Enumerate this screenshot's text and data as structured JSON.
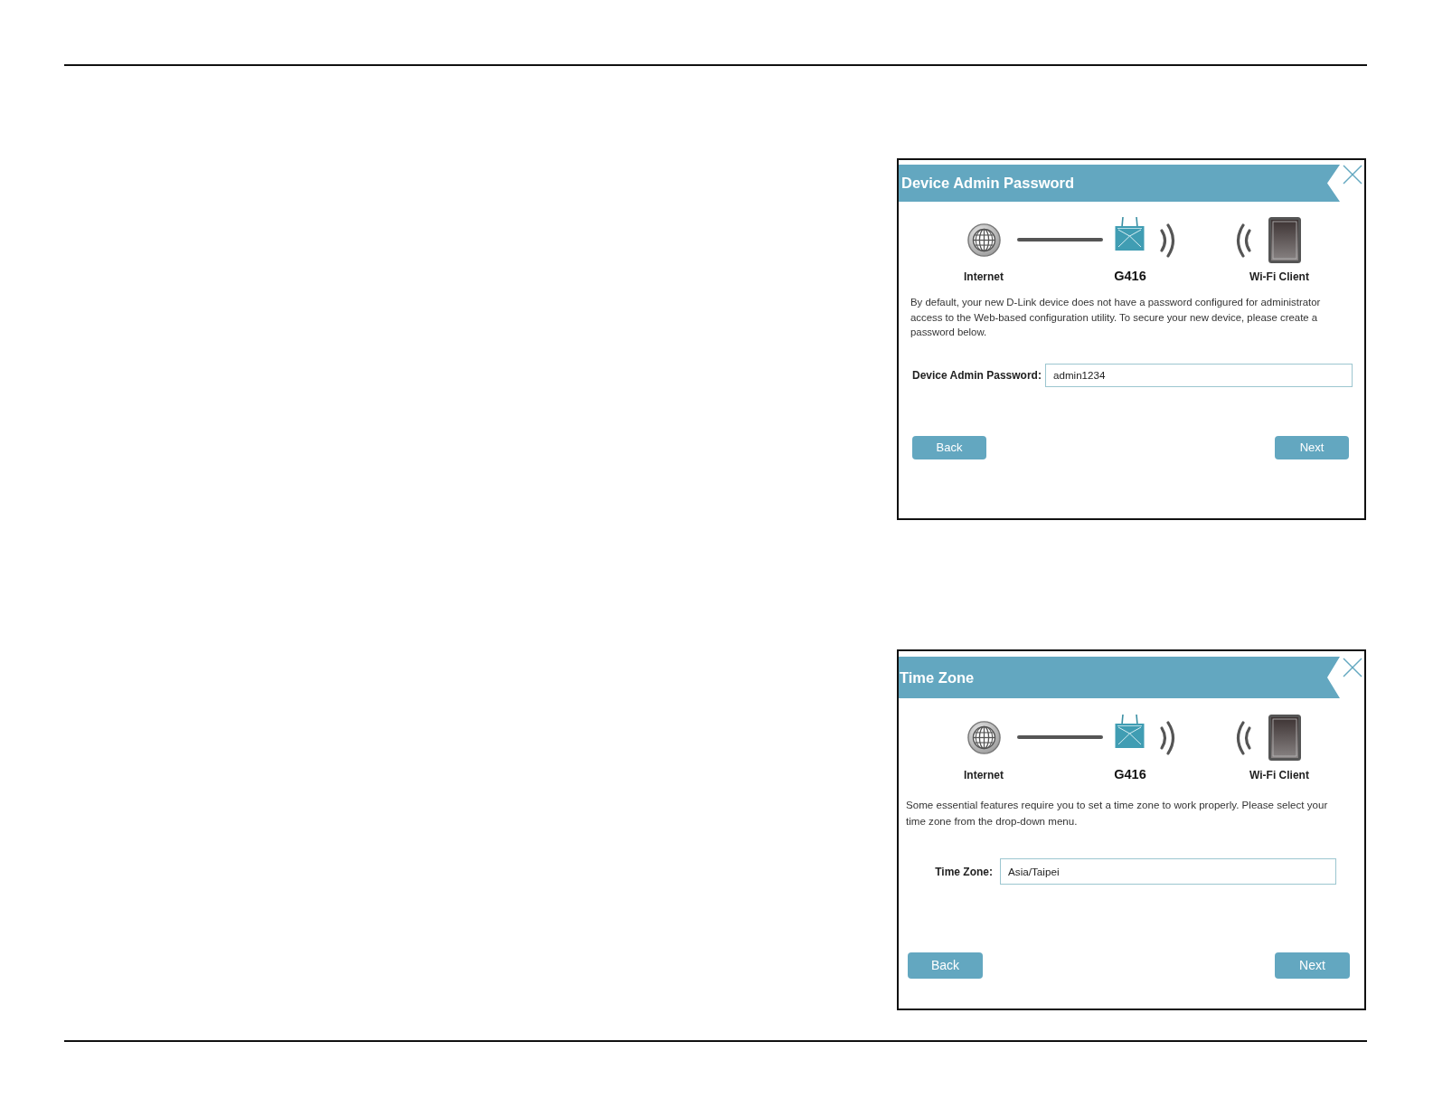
{
  "dialogs": [
    {
      "title": "Device Admin Password",
      "diagram": {
        "internet_label": "Internet",
        "device_label": "G416",
        "client_label": "Wi-Fi Client"
      },
      "description": "By default, your new D-Link device does not have a password configured for administrator access to the Web-based configuration utility. To secure your new device, please create a password below.",
      "field": {
        "label": "Device Admin Password:",
        "value": "admin1234"
      },
      "buttons": [
        "Back",
        "Next"
      ]
    },
    {
      "title": "Time Zone",
      "diagram": {
        "internet_label": "Internet",
        "device_label": "G416",
        "client_label": "Wi-Fi Client"
      },
      "description": "Some essential features require you to set a time zone to work properly. Please select your time zone from the drop-down menu.",
      "field": {
        "label": "Time Zone:",
        "value": "Asia/Taipei"
      },
      "buttons": [
        "Back",
        "Next"
      ]
    }
  ]
}
